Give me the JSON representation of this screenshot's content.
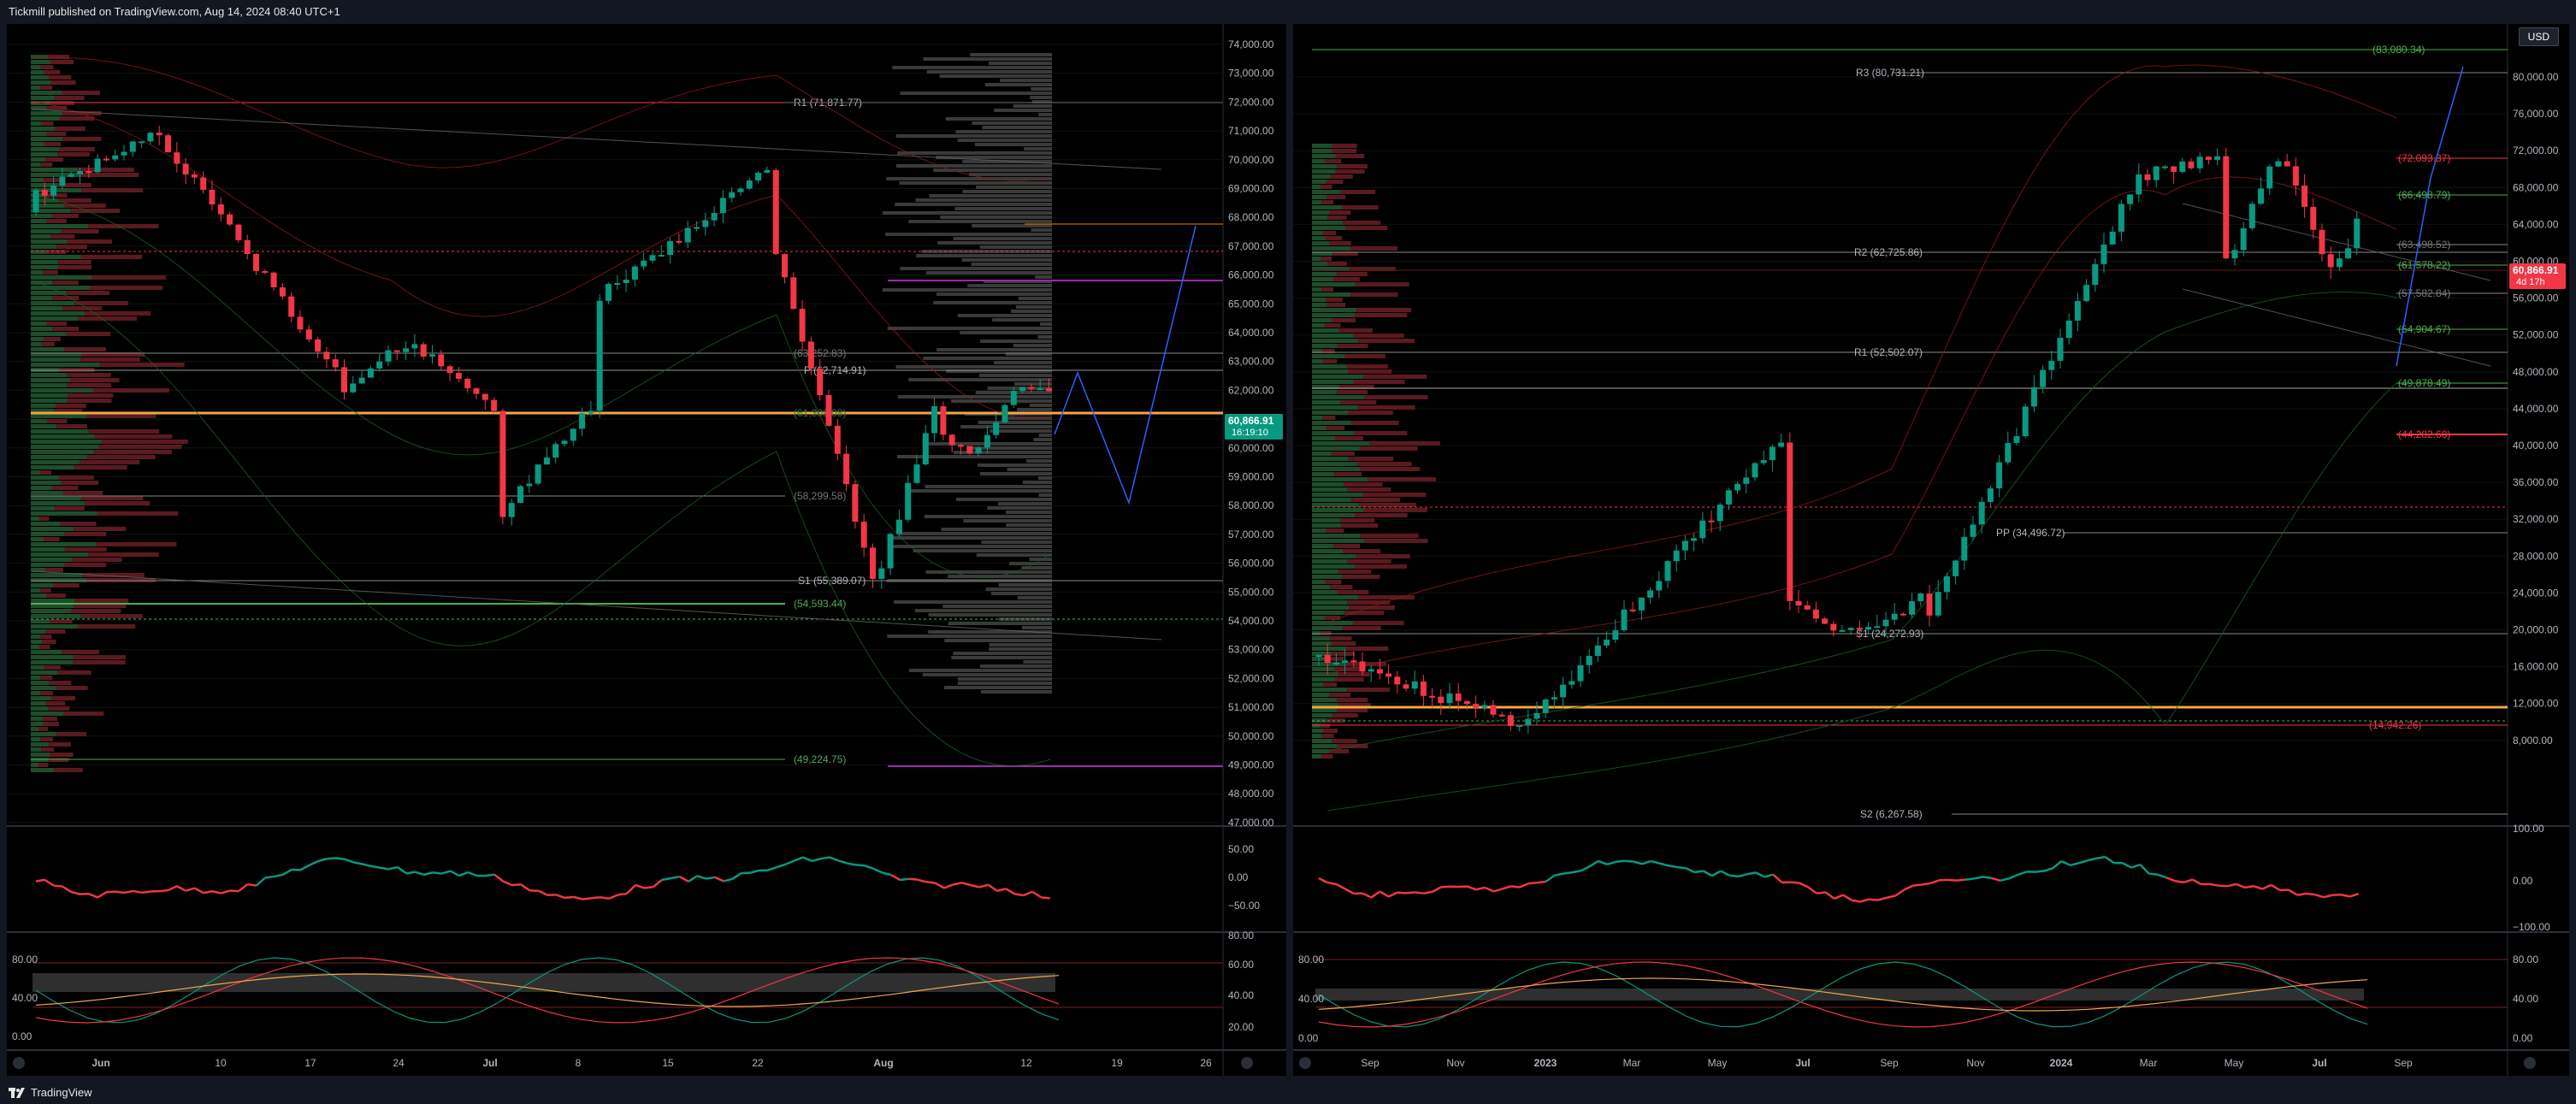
{
  "header": {
    "published": "Tickmill published on TradingView.com, Aug 14, 2024 08:40 UTC+1"
  },
  "footer": {
    "brand": "TradingView"
  },
  "left": {
    "price_ticks": [
      "74,000.00",
      "73,000.00",
      "72,000.00",
      "71,000.00",
      "70,000.00",
      "69,000.00",
      "68,000.00",
      "67,000.00",
      "66,000.00",
      "65,000.00",
      "64,000.00",
      "63,000.00",
      "62,000.00",
      "61,000.00",
      "60,000.00",
      "59,000.00",
      "58,000.00",
      "57,000.00",
      "56,000.00",
      "55,000.00",
      "54,000.00",
      "53,000.00",
      "52,000.00",
      "51,000.00",
      "50,000.00",
      "49,000.00",
      "48,000.00",
      "47,000.00"
    ],
    "levels": {
      "r1": "R1 (71,871.77)",
      "p": "P (62,714.91)",
      "v1": "(63,252.83)",
      "v2": "(61,309.08)",
      "v3": "(58,299.58)",
      "s1": "S1 (55,389.07)",
      "v4": "(54,593.44)",
      "v5": "(49,224.75)"
    },
    "last_price": "60,866.91",
    "countdown": "16:19:10",
    "osc1_ticks": [
      "50.00",
      "0.00",
      "−50.00"
    ],
    "osc2_ticks": [
      "80.00",
      "60.00",
      "40.00",
      "20.00"
    ],
    "osc2_left_ticks": [
      "80.00",
      "40.00",
      "0.00"
    ],
    "time_ticks": [
      "Jun",
      "10",
      "17",
      "24",
      "Jul",
      "8",
      "15",
      "22",
      "Aug",
      "12",
      "19",
      "26"
    ]
  },
  "right": {
    "currency": "USD",
    "price_ticks": [
      "80,000.00",
      "76,000.00",
      "72,000.00",
      "68,000.00",
      "64,000.00",
      "60,000.00",
      "56,000.00",
      "52,000.00",
      "48,000.00",
      "44,000.00",
      "40,000.00",
      "36,000.00",
      "32,000.00",
      "28,000.00",
      "24,000.00",
      "20,000.00",
      "16,000.00",
      "12,000.00",
      "8,000.00"
    ],
    "levels": {
      "top": "(83,080.34)",
      "r3": "R3 (80,731.21)",
      "red1": "(72,093.37)",
      "g1": "(66,498.79)",
      "g2": "(63,498.52)",
      "r2": "R2 (62,725.86)",
      "g3": "(61,578.22)",
      "g4": "(57,582.84)",
      "g5": "(54,904.67)",
      "r1": "R1 (52,502.07)",
      "g6": "(49,878.49)",
      "red2": "(44,282.68)",
      "pp": "PP (34,496.72)",
      "s1": "S1 (24,272.93)",
      "red3": "(14,942.26)",
      "s2": "S2 (6,267.58)"
    },
    "last_price": "60,866.91",
    "countdown": "4d 17h",
    "osc1_ticks": [
      "100.00",
      "0.00",
      "−100.00"
    ],
    "osc2_ticks": [
      "80.00",
      "40.00",
      "0.00"
    ],
    "osc2_left_ticks": [
      "80.00",
      "40.00",
      "0.00"
    ],
    "time_ticks": [
      "Sep",
      "Nov",
      "2023",
      "Mar",
      "May",
      "Jul",
      "Sep",
      "Nov",
      "2024",
      "Mar",
      "May",
      "Jul",
      "Sep"
    ]
  },
  "colors": {
    "up": "#089981",
    "down": "#f23645",
    "bg": "#000000",
    "panel": "#131722"
  }
}
